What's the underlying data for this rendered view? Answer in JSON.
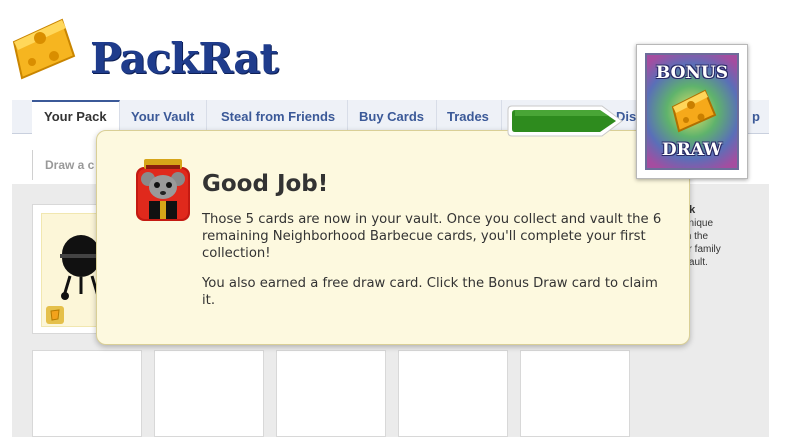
{
  "app": {
    "logo_text": "PackRat"
  },
  "tabs": [
    {
      "label": "Your Pack",
      "active": true
    },
    {
      "label": "Your Vault",
      "active": false
    },
    {
      "label": "Steal from Friends",
      "active": false
    },
    {
      "label": "Buy Cards",
      "active": false
    },
    {
      "label": "Trades",
      "active": false
    },
    {
      "label": "Disc",
      "active": false
    },
    {
      "label": "p",
      "active": false
    }
  ],
  "subnav": {
    "label": "Draw a c"
  },
  "sidebar_info": {
    "heading": "ck",
    "lines": [
      "unique",
      "m the",
      "or family",
      "Vault."
    ]
  },
  "bonus_card": {
    "top_text": "BONUS",
    "bottom_text": "DRAW"
  },
  "dialog": {
    "title": "Good Job!",
    "paragraph1": "Those 5 cards are now in your vault. Once you collect and vault the 6 remaining Neighborhood Barbecue cards, you'll complete your first collection!",
    "paragraph2": "You also earned a free draw card. Click the Bonus Draw card to claim it."
  },
  "icons": {
    "logo": "cheese-icon",
    "card_image": "grill-icon",
    "card_badge": "cheese-badge-icon",
    "dialog": "rat-icon",
    "pointer": "arrow-right-icon"
  },
  "colors": {
    "accent": "#3b5998",
    "dialog_bg": "#fdf9df",
    "arrow": "#2e8b1e"
  }
}
